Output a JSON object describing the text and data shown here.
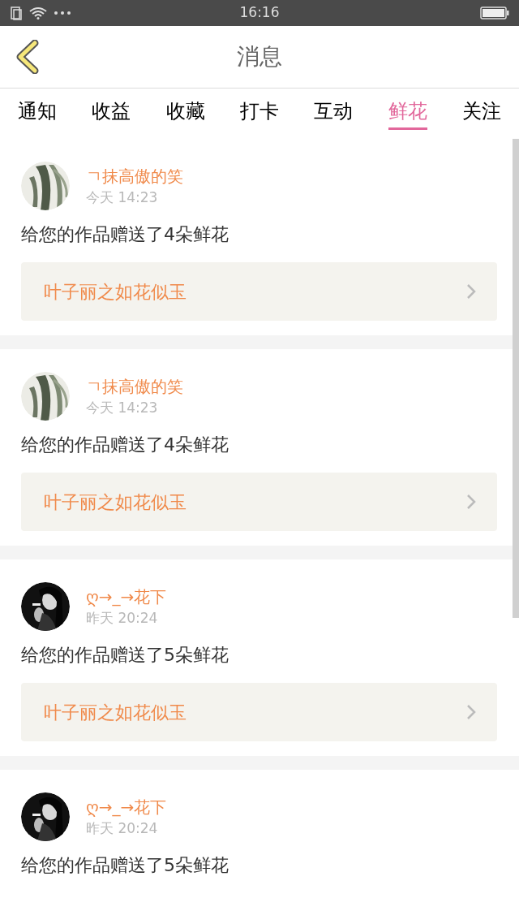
{
  "status_bar": {
    "time": "16:16"
  },
  "header": {
    "title": "消息"
  },
  "tabs": [
    {
      "label": "通知",
      "selected": false
    },
    {
      "label": "收益",
      "selected": false
    },
    {
      "label": "收藏",
      "selected": false
    },
    {
      "label": "打卡",
      "selected": false
    },
    {
      "label": "互动",
      "selected": false
    },
    {
      "label": "鲜花",
      "selected": true
    },
    {
      "label": "关注",
      "selected": false
    }
  ],
  "messages": [
    {
      "user": "ㄱ抹高傲的笑",
      "time": "今天 14:23",
      "text": "给您的作品赠送了4朵鲜花",
      "work": "叶子丽之如花似玉"
    },
    {
      "user": "ㄱ抹高傲的笑",
      "time": "今天 14:23",
      "text": "给您的作品赠送了4朵鲜花",
      "work": "叶子丽之如花似玉"
    },
    {
      "user": "ღ→_→花下",
      "time": "昨天 20:24",
      "text": "给您的作品赠送了5朵鲜花",
      "work": "叶子丽之如花似玉"
    },
    {
      "user": "ღ→_→花下",
      "time": "昨天 20:24",
      "text": "给您的作品赠送了5朵鲜花"
    }
  ]
}
